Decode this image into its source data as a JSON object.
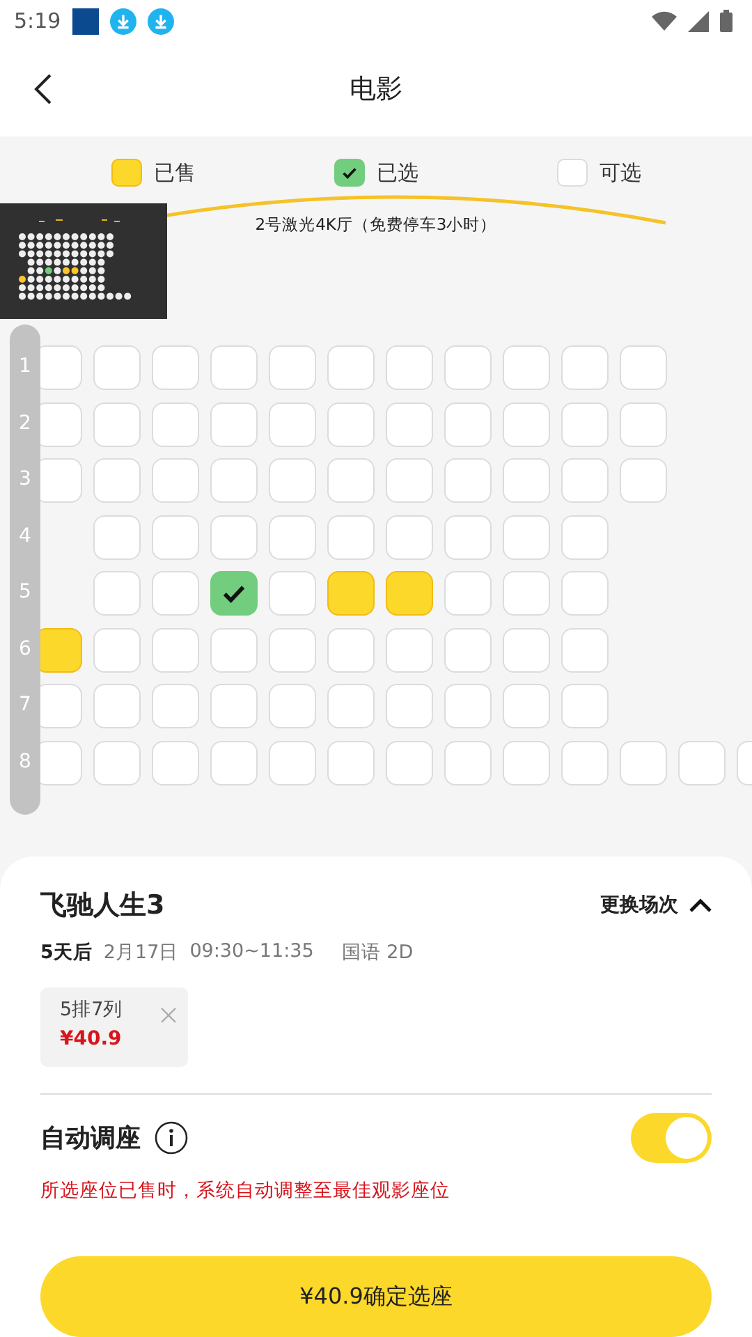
{
  "status_bar": {
    "time": "5:19"
  },
  "header": {
    "title": "电影"
  },
  "legend": [
    {
      "kind": "sold",
      "label": "已售"
    },
    {
      "kind": "selected",
      "label": "已选"
    },
    {
      "kind": "available",
      "label": "可选"
    }
  ],
  "screen": {
    "hall": "2号激光4K厅（免费停车3小时）"
  },
  "rows": [
    {
      "label": "1",
      "seats": [
        {
          "kind": "seat",
          "sold": false,
          "selected": false
        },
        {
          "kind": "seat",
          "sold": false,
          "selected": false
        },
        {
          "kind": "seat",
          "sold": false,
          "selected": false
        },
        {
          "kind": "seat",
          "sold": false,
          "selected": false
        },
        {
          "kind": "seat",
          "sold": false,
          "selected": false
        },
        {
          "kind": "seat",
          "sold": false,
          "selected": false
        },
        {
          "kind": "seat",
          "sold": false,
          "selected": false
        },
        {
          "kind": "seat",
          "sold": false,
          "selected": false
        },
        {
          "kind": "seat",
          "sold": false,
          "selected": false
        },
        {
          "kind": "seat",
          "sold": false,
          "selected": false
        },
        {
          "kind": "seat",
          "sold": false,
          "selected": false
        }
      ]
    },
    {
      "label": "2",
      "seats": [
        {
          "kind": "seat",
          "sold": false,
          "selected": false
        },
        {
          "kind": "seat",
          "sold": false,
          "selected": false
        },
        {
          "kind": "seat",
          "sold": false,
          "selected": false
        },
        {
          "kind": "seat",
          "sold": false,
          "selected": false
        },
        {
          "kind": "seat",
          "sold": false,
          "selected": false
        },
        {
          "kind": "seat",
          "sold": false,
          "selected": false
        },
        {
          "kind": "seat",
          "sold": false,
          "selected": false
        },
        {
          "kind": "seat",
          "sold": false,
          "selected": false
        },
        {
          "kind": "seat",
          "sold": false,
          "selected": false
        },
        {
          "kind": "seat",
          "sold": false,
          "selected": false
        },
        {
          "kind": "seat",
          "sold": false,
          "selected": false
        }
      ]
    },
    {
      "label": "3",
      "seats": [
        {
          "kind": "seat",
          "sold": false,
          "selected": false
        },
        {
          "kind": "seat",
          "sold": false,
          "selected": false
        },
        {
          "kind": "seat",
          "sold": false,
          "selected": false
        },
        {
          "kind": "seat",
          "sold": false,
          "selected": false
        },
        {
          "kind": "seat",
          "sold": false,
          "selected": false
        },
        {
          "kind": "seat",
          "sold": false,
          "selected": false
        },
        {
          "kind": "seat",
          "sold": false,
          "selected": false
        },
        {
          "kind": "seat",
          "sold": false,
          "selected": false
        },
        {
          "kind": "seat",
          "sold": false,
          "selected": false
        },
        {
          "kind": "seat",
          "sold": false,
          "selected": false
        },
        {
          "kind": "seat",
          "sold": false,
          "selected": false
        }
      ]
    },
    {
      "label": "4",
      "seats": [
        {
          "kind": "gap"
        },
        {
          "kind": "seat",
          "sold": false,
          "selected": false
        },
        {
          "kind": "seat",
          "sold": false,
          "selected": false
        },
        {
          "kind": "seat",
          "sold": false,
          "selected": false
        },
        {
          "kind": "seat",
          "sold": false,
          "selected": false
        },
        {
          "kind": "seat",
          "sold": false,
          "selected": false
        },
        {
          "kind": "seat",
          "sold": false,
          "selected": false
        },
        {
          "kind": "seat",
          "sold": false,
          "selected": false
        },
        {
          "kind": "seat",
          "sold": false,
          "selected": false
        },
        {
          "kind": "seat",
          "sold": false,
          "selected": false
        }
      ]
    },
    {
      "label": "5",
      "seats": [
        {
          "kind": "gap"
        },
        {
          "kind": "seat",
          "sold": false,
          "selected": false
        },
        {
          "kind": "seat",
          "sold": false,
          "selected": false
        },
        {
          "kind": "seat",
          "sold": false,
          "selected": true
        },
        {
          "kind": "seat",
          "sold": false,
          "selected": false
        },
        {
          "kind": "seat",
          "sold": true,
          "selected": false
        },
        {
          "kind": "seat",
          "sold": true,
          "selected": false
        },
        {
          "kind": "seat",
          "sold": false,
          "selected": false
        },
        {
          "kind": "seat",
          "sold": false,
          "selected": false
        },
        {
          "kind": "seat",
          "sold": false,
          "selected": false
        }
      ]
    },
    {
      "label": "6",
      "seats": [
        {
          "kind": "seat",
          "sold": true,
          "selected": false
        },
        {
          "kind": "seat",
          "sold": false,
          "selected": false
        },
        {
          "kind": "seat",
          "sold": false,
          "selected": false
        },
        {
          "kind": "seat",
          "sold": false,
          "selected": false
        },
        {
          "kind": "seat",
          "sold": false,
          "selected": false
        },
        {
          "kind": "seat",
          "sold": false,
          "selected": false
        },
        {
          "kind": "seat",
          "sold": false,
          "selected": false
        },
        {
          "kind": "seat",
          "sold": false,
          "selected": false
        },
        {
          "kind": "seat",
          "sold": false,
          "selected": false
        },
        {
          "kind": "seat",
          "sold": false,
          "selected": false
        }
      ]
    },
    {
      "label": "7",
      "seats": [
        {
          "kind": "seat",
          "sold": false,
          "selected": false
        },
        {
          "kind": "seat",
          "sold": false,
          "selected": false
        },
        {
          "kind": "seat",
          "sold": false,
          "selected": false
        },
        {
          "kind": "seat",
          "sold": false,
          "selected": false
        },
        {
          "kind": "seat",
          "sold": false,
          "selected": false
        },
        {
          "kind": "seat",
          "sold": false,
          "selected": false
        },
        {
          "kind": "seat",
          "sold": false,
          "selected": false
        },
        {
          "kind": "seat",
          "sold": false,
          "selected": false
        },
        {
          "kind": "seat",
          "sold": false,
          "selected": false
        },
        {
          "kind": "seat",
          "sold": false,
          "selected": false
        }
      ]
    },
    {
      "label": "8",
      "seats": [
        {
          "kind": "seat",
          "sold": false,
          "selected": false
        },
        {
          "kind": "seat",
          "sold": false,
          "selected": false
        },
        {
          "kind": "seat",
          "sold": false,
          "selected": false
        },
        {
          "kind": "seat",
          "sold": false,
          "selected": false
        },
        {
          "kind": "seat",
          "sold": false,
          "selected": false
        },
        {
          "kind": "seat",
          "sold": false,
          "selected": false
        },
        {
          "kind": "seat",
          "sold": false,
          "selected": false
        },
        {
          "kind": "seat",
          "sold": false,
          "selected": false
        },
        {
          "kind": "seat",
          "sold": false,
          "selected": false
        },
        {
          "kind": "seat",
          "sold": false,
          "selected": false
        },
        {
          "kind": "seat",
          "sold": false,
          "selected": false
        },
        {
          "kind": "seat",
          "sold": false,
          "selected": false
        },
        {
          "kind": "seat",
          "sold": false,
          "selected": false
        }
      ]
    }
  ],
  "movie": {
    "title": "飞驰人生3",
    "change": "更换场次",
    "expanded": true,
    "when": "5天后",
    "date": "2月17日",
    "time": "09:30~11:35",
    "format": "国语 2D"
  },
  "tickets": [
    {
      "seat": "5排7列",
      "price": "¥40.9"
    }
  ],
  "auto_adjust": {
    "label": "自动调座",
    "on": true,
    "note": "所选座位已售时，系统自动调整至最佳观影座位"
  },
  "confirm": {
    "label": "¥40.9确定选座"
  }
}
